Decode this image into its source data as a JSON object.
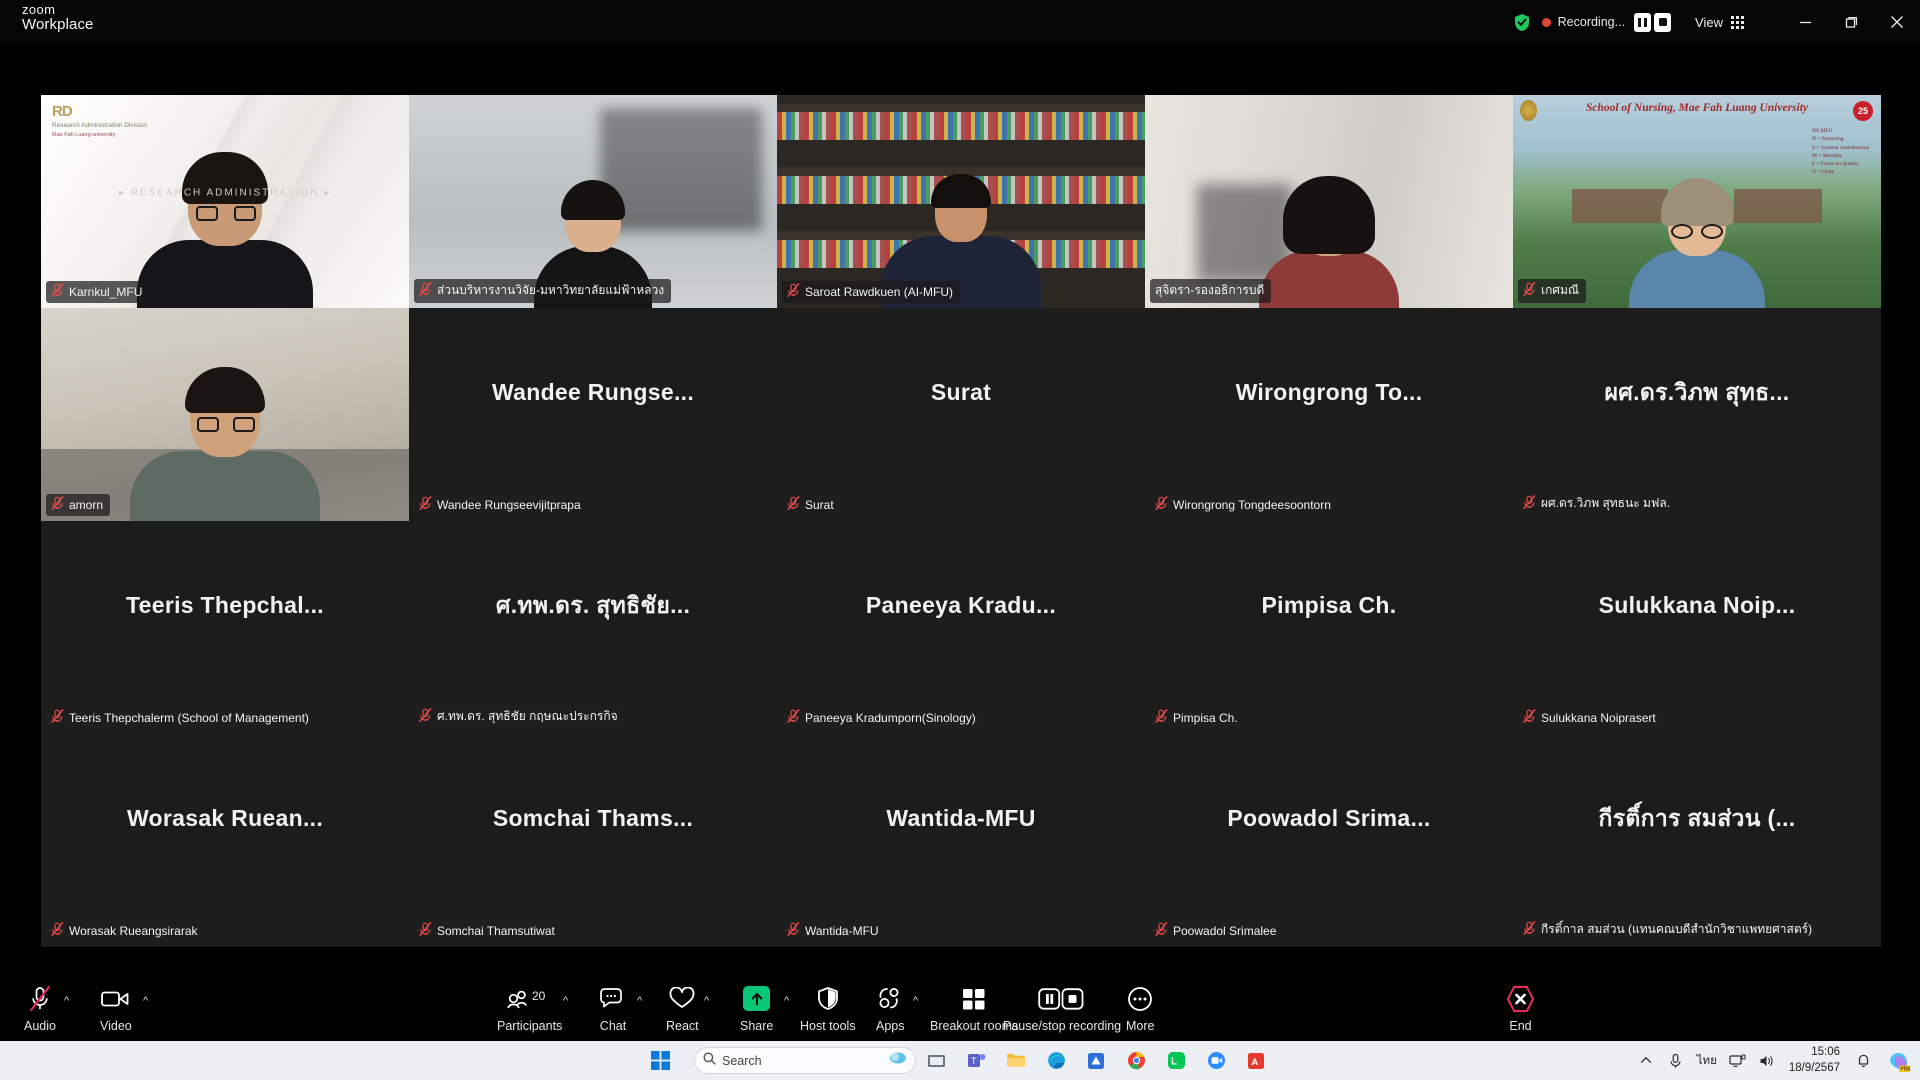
{
  "titlebar": {
    "app_name": "zoom",
    "app_subtitle": "Workplace",
    "recording_label": "Recording...",
    "view_label": "View",
    "shield_icon": "security-shield-icon",
    "minimize_icon": "minimize-icon",
    "maximize_icon": "restore-icon",
    "close_icon": "close-icon",
    "accent_green": "#1ec95d",
    "record_red": "#e5443d"
  },
  "gallery": {
    "speaking_border_color": "#1ec95d",
    "tiles": [
      {
        "name": "Karnkul_MFU",
        "display": "",
        "video": true,
        "muted": true,
        "speaking": false,
        "bg": "bg-a"
      },
      {
        "name": "ส่วนบริหารงานวิจัย-มหาวิทยาลัยแม่ฟ้าหลวง",
        "display": "",
        "video": true,
        "muted": true,
        "speaking": false,
        "bg": "bg-b"
      },
      {
        "name": "Saroat Rawdkuen (AI-MFU)",
        "display": "",
        "video": true,
        "muted": true,
        "speaking": false,
        "bg": "bg-c"
      },
      {
        "name": "สุจิตรา-รองอธิการบดี",
        "display": "",
        "video": true,
        "muted": false,
        "speaking": true,
        "bg": "bg-d"
      },
      {
        "name": "เกศมณี",
        "display": "",
        "video": true,
        "muted": true,
        "speaking": false,
        "bg": "bg-e"
      },
      {
        "name": "amorn",
        "display": "",
        "video": true,
        "muted": true,
        "speaking": false,
        "bg": "bg-f"
      },
      {
        "name": "Wandee Rungseevijitprapa",
        "display": "Wandee  Rungse...",
        "video": false,
        "muted": true,
        "speaking": false,
        "bg": ""
      },
      {
        "name": "Surat",
        "display": "Surat",
        "video": false,
        "muted": true,
        "speaking": false,
        "bg": ""
      },
      {
        "name": "Wirongrong Tongdeesoontorn",
        "display": "Wirongrong  To...",
        "video": false,
        "muted": true,
        "speaking": false,
        "bg": ""
      },
      {
        "name": "ผศ.ดร.วิภพ สุทธนะ มฟล.",
        "display": "ผศ.ดร.วิภพ สุทธ...",
        "video": false,
        "muted": true,
        "speaking": false,
        "bg": ""
      },
      {
        "name": "Teeris Thepchalerm (School of Management)",
        "display": "Teeris  Thepchal...",
        "video": false,
        "muted": true,
        "speaking": false,
        "bg": ""
      },
      {
        "name": "ศ.ทพ.ดร. สุทธิชัย กฤษณะประกรกิจ",
        "display": "ศ.ทพ.ดร. สุทธิชัย...",
        "video": false,
        "muted": true,
        "speaking": false,
        "bg": ""
      },
      {
        "name": "Paneeya Kradumporn(Sinology)",
        "display": "Paneeya  Kradu...",
        "video": false,
        "muted": true,
        "speaking": false,
        "bg": ""
      },
      {
        "name": "Pimpisa Ch.",
        "display": "Pimpisa Ch.",
        "video": false,
        "muted": true,
        "speaking": false,
        "bg": ""
      },
      {
        "name": "Sulukkana Noiprasert",
        "display": "Sulukkana  Noip...",
        "video": false,
        "muted": true,
        "speaking": false,
        "bg": ""
      },
      {
        "name": "Worasak Rueangsirarak",
        "display": "Worasak  Ruean...",
        "video": false,
        "muted": true,
        "speaking": false,
        "bg": ""
      },
      {
        "name": "Somchai Thamsutiwat",
        "display": "Somchai  Thams...",
        "video": false,
        "muted": true,
        "speaking": false,
        "bg": ""
      },
      {
        "name": "Wantida-MFU",
        "display": "Wantida-MFU",
        "video": false,
        "muted": true,
        "speaking": false,
        "bg": ""
      },
      {
        "name": "Poowadol Srimalee",
        "display": "Poowadol  Srima...",
        "video": false,
        "muted": true,
        "speaking": false,
        "bg": ""
      },
      {
        "name": "กีรติ์กาล สมส่วน (แทนคณบดีสำนักวิชาแพทยศาสตร์)",
        "display": "กีรติ์การ สมส่วน (...",
        "video": false,
        "muted": true,
        "speaking": false,
        "bg": ""
      }
    ],
    "video_backgrounds": {
      "tile1_logo_title": "Research Administration Division",
      "tile1_logo_sub": "Mae Fah Luang university",
      "tile1_logo_mark": "RD",
      "tile1_watermark": "RESEARCH ADMINISTRATION",
      "tile5_title": "School of Nursing, Mae Fah Luang University",
      "tile5_badge": "25",
      "tile5_values": "NS MFU\nN = Nurturing\nS = Societal contributions\nM = Morality\nF = Focus on Quality and Innovation\nU = Unity"
    }
  },
  "toolbar": {
    "audio": {
      "label": "Audio",
      "icon": "microphone-muted-icon",
      "muted": true
    },
    "video": {
      "label": "Video",
      "icon": "camera-icon"
    },
    "participants": {
      "label": "Participants",
      "count": "20",
      "icon": "people-icon"
    },
    "chat": {
      "label": "Chat",
      "icon": "chat-bubble-icon"
    },
    "react": {
      "label": "React",
      "icon": "heart-icon"
    },
    "share": {
      "label": "Share",
      "icon": "share-screen-icon",
      "color": "#0ac775"
    },
    "host_tools": {
      "label": "Host tools",
      "icon": "shield-icon"
    },
    "apps": {
      "label": "Apps",
      "icon": "apps-icon"
    },
    "breakout": {
      "label": "Breakout rooms",
      "icon": "grid-squares-icon"
    },
    "recording": {
      "label": "Pause/stop recording",
      "icon": "pause-stop-icon"
    },
    "more": {
      "label": "More",
      "icon": "ellipsis-icon"
    },
    "end": {
      "label": "End",
      "icon": "end-call-icon",
      "color": "#e02c56"
    }
  },
  "taskbar": {
    "start_icon": "windows-start-icon",
    "search_placeholder": "Search",
    "search_icon": "search-icon",
    "time": "15:06",
    "date": "18/9/2567",
    "language": "ไทย",
    "icons": [
      "task-view-icon",
      "teams-icon",
      "file-explorer-icon",
      "edge-icon",
      "store-icon",
      "chrome-icon",
      "line-icon",
      "zoom-icon",
      "acrobat-icon"
    ],
    "tray": [
      "chevron-up-icon",
      "microphone-icon",
      "display-icon",
      "speaker-icon",
      "notification-bell-icon",
      "copilot-icon"
    ]
  }
}
